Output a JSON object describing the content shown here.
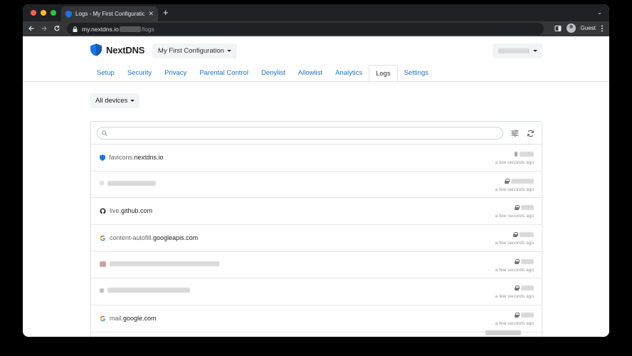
{
  "browser": {
    "tab_title": "Logs - My First Configuration -",
    "tab_close": "✕",
    "new_tab": "+",
    "menu_glyph": "⌄",
    "url_host": "my.nextdns.io",
    "url_path": "/logs",
    "guest_label": "Guest",
    "dot_colors": [
      "#ff5f57",
      "#febc2e",
      "#28c840"
    ]
  },
  "header": {
    "logo_text": "NextDNS",
    "config_name": "My First Configuration",
    "accent_color": "#1a73c8"
  },
  "nav": {
    "tabs": [
      {
        "label": "Setup"
      },
      {
        "label": "Security"
      },
      {
        "label": "Privacy"
      },
      {
        "label": "Parental Control"
      },
      {
        "label": "Denylist"
      },
      {
        "label": "Allowlist"
      },
      {
        "label": "Analytics"
      },
      {
        "label": "Logs",
        "active": true
      },
      {
        "label": "Settings"
      }
    ]
  },
  "filters": {
    "device_selector": "All devices",
    "search_placeholder": ""
  },
  "logs": [
    {
      "icon": "nextdns-shield-icon",
      "sub": "favicons.",
      "domain": "nextdns.io",
      "time": "a few seconds ago",
      "locked": false
    },
    {
      "icon": "blurred-icon",
      "sub": "",
      "domain": "",
      "time": "a few seconds ago",
      "locked": true
    },
    {
      "icon": "github-icon",
      "sub": "live.",
      "domain": "github.com",
      "time": "a few seconds ago",
      "locked": true
    },
    {
      "icon": "google-icon",
      "sub": "content-autofill.",
      "domain": "googleapis.com",
      "time": "a few seconds ago",
      "locked": true
    },
    {
      "icon": "blurred-icon",
      "sub": "",
      "domain": "",
      "time": "a few seconds ago",
      "locked": true
    },
    {
      "icon": "blurred-icon",
      "sub": "",
      "domain": "",
      "time": "a few seconds ago",
      "locked": true
    },
    {
      "icon": "google-icon",
      "sub": "mail.",
      "domain": "google.com",
      "time": "a few seconds ago",
      "locked": true
    }
  ]
}
